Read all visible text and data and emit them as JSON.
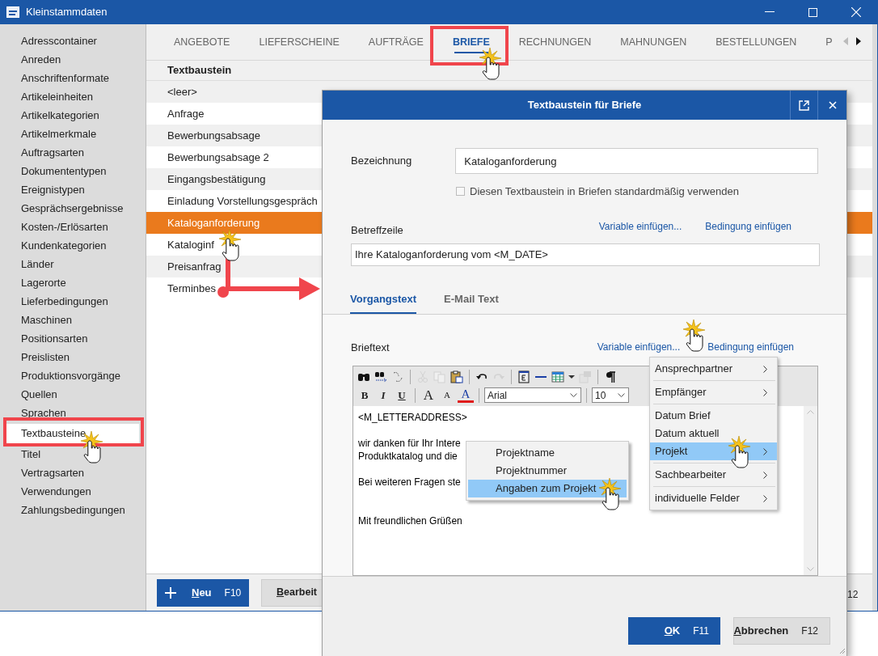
{
  "window": {
    "title": "Kleinstammdaten"
  },
  "sidebar": {
    "items": [
      {
        "label": "Adresscontainer",
        "selected": false
      },
      {
        "label": "Anreden",
        "selected": false
      },
      {
        "label": "Anschriftenformate",
        "selected": false
      },
      {
        "label": "Artikeleinheiten",
        "selected": false
      },
      {
        "label": "Artikelkategorien",
        "selected": false
      },
      {
        "label": "Artikelmerkmale",
        "selected": false
      },
      {
        "label": "Auftragsarten",
        "selected": false
      },
      {
        "label": "Dokumententypen",
        "selected": false
      },
      {
        "label": "Ereignistypen",
        "selected": false
      },
      {
        "label": "Gesprächsergebnisse",
        "selected": false
      },
      {
        "label": "Kosten-/Erlösarten",
        "selected": false
      },
      {
        "label": "Kundenkategorien",
        "selected": false
      },
      {
        "label": "Länder",
        "selected": false
      },
      {
        "label": "Lagerorte",
        "selected": false
      },
      {
        "label": "Lieferbedingungen",
        "selected": false
      },
      {
        "label": "Maschinen",
        "selected": false
      },
      {
        "label": "Positionsarten",
        "selected": false
      },
      {
        "label": "Preislisten",
        "selected": false
      },
      {
        "label": "Produktionsvorgänge",
        "selected": false
      },
      {
        "label": "Quellen",
        "selected": false
      },
      {
        "label": "Sprachen",
        "selected": false
      },
      {
        "label": "Textbausteine",
        "selected": true
      },
      {
        "label": "Titel",
        "selected": false
      },
      {
        "label": "Vertragsarten",
        "selected": false
      },
      {
        "label": "Verwendungen",
        "selected": false
      },
      {
        "label": "Zahlungsbedingungen",
        "selected": false
      }
    ]
  },
  "tabs": [
    {
      "label": "ANGEBOTE",
      "selected": false
    },
    {
      "label": "LIEFERSCHEINE",
      "selected": false
    },
    {
      "label": "AUFTRÄGE",
      "selected": false
    },
    {
      "label": "BRIEFE",
      "selected": true
    },
    {
      "label": "RECHNUNGEN",
      "selected": false
    },
    {
      "label": "MAHNUNGEN",
      "selected": false
    },
    {
      "label": "BESTELLUNGEN",
      "selected": false
    },
    {
      "label": "P",
      "selected": false
    }
  ],
  "list": {
    "header": "Textbaustein",
    "rows": [
      {
        "label": "<leer>",
        "selected": false
      },
      {
        "label": "Anfrage",
        "selected": false
      },
      {
        "label": "Bewerbungsabsage",
        "selected": false
      },
      {
        "label": "Bewerbungsabsage 2",
        "selected": false
      },
      {
        "label": "Eingangsbestätigung",
        "selected": false
      },
      {
        "label": "Einladung Vorstellungsgespräch",
        "selected": false
      },
      {
        "label": "Kataloganforderung",
        "selected": true
      },
      {
        "label": "Kataloginf",
        "selected": false
      },
      {
        "label": "Preisanfrag",
        "selected": false
      },
      {
        "label": "Terminbes",
        "selected": false
      }
    ]
  },
  "bottom_bar": {
    "buttons": [
      {
        "label": "Neu",
        "key": "F10",
        "kind": "primary"
      },
      {
        "label": "Bearbeit",
        "kind": "secondary"
      }
    ],
    "cut_key": "12"
  },
  "dialog": {
    "title": "Textbaustein für Briefe",
    "name_label": "Bezeichnung",
    "name_value": "Kataloganforderung",
    "default_checkbox": {
      "label": "Diesen Textbaustein in Briefen standardmäßig verwenden",
      "checked": false
    },
    "subject_label": "Betreffzeile",
    "subject_links": [
      "Variable einfügen...",
      "Bedingung einfügen"
    ],
    "subject_value": "Ihre Kataloganforderung vom <M_DATE>",
    "tabs": [
      {
        "label": "Vorgangstext",
        "selected": true
      },
      {
        "label": "E-Mail Text",
        "selected": false
      }
    ],
    "body_label": "Brieftext",
    "body_links": [
      "Variable einfügen...",
      "Bedingung einfügen"
    ],
    "toolbar": {
      "row1": [
        {
          "kind": "find",
          "disabled": false
        },
        {
          "kind": "find-next",
          "disabled": false
        },
        {
          "kind": "replace",
          "disabled": false
        },
        {
          "kind": "sep"
        },
        {
          "kind": "cut",
          "disabled": true
        },
        {
          "kind": "copy",
          "disabled": true
        },
        {
          "kind": "paste",
          "disabled": false
        },
        {
          "kind": "sep"
        },
        {
          "kind": "undo",
          "disabled": false
        },
        {
          "kind": "redo",
          "disabled": true
        },
        {
          "kind": "sep"
        },
        {
          "kind": "field",
          "disabled": false
        },
        {
          "kind": "rule",
          "disabled": false
        },
        {
          "kind": "table",
          "disabled": false
        },
        {
          "kind": "caret",
          "disabled": false
        },
        {
          "kind": "properties",
          "disabled": true
        },
        {
          "kind": "sep"
        },
        {
          "kind": "pilcrow",
          "disabled": false
        }
      ],
      "row2": [
        {
          "kind": "bold",
          "glyph": "B"
        },
        {
          "kind": "italic",
          "glyph": "I"
        },
        {
          "kind": "underline",
          "glyph": "U"
        },
        {
          "kind": "sep"
        },
        {
          "kind": "grow",
          "glyph": "A"
        },
        {
          "kind": "shrink",
          "glyph": "A"
        },
        {
          "kind": "color",
          "glyph": "A"
        },
        {
          "kind": "sep"
        }
      ],
      "font": "Arial",
      "size": "10"
    },
    "body_lines": [
      {
        "kind": "text",
        "text": "<M_LETTERADDRESS>"
      },
      {
        "kind": "gap"
      },
      {
        "kind": "text",
        "text": "wir danken für Ihr Intere"
      },
      {
        "kind": "text",
        "text": "Produktkatalog und die"
      },
      {
        "kind": "gap"
      },
      {
        "kind": "text",
        "text": "Bei weiteren Fragen ste"
      },
      {
        "kind": "gap"
      },
      {
        "kind": "gap"
      },
      {
        "kind": "text",
        "text": "Mit freundlichen Grüßen"
      }
    ],
    "buttons": [
      {
        "label": "OK",
        "key": "F11",
        "kind": "primary"
      },
      {
        "label": "Abbrechen",
        "key": "F12",
        "kind": "secondary"
      }
    ]
  },
  "variable_menu": {
    "groups": [
      [
        {
          "label": "Ansprechpartner",
          "has_submenu": true,
          "selected": false
        }
      ],
      [
        {
          "label": "Empfänger",
          "has_submenu": true,
          "selected": false
        }
      ],
      [
        {
          "label": "Datum Brief",
          "has_submenu": false,
          "selected": false
        },
        {
          "label": "Datum aktuell",
          "has_submenu": false,
          "selected": false
        },
        {
          "label": "Projekt",
          "has_submenu": true,
          "selected": true
        }
      ],
      [
        {
          "label": "Sachbearbeiter",
          "has_submenu": true,
          "selected": false
        }
      ],
      [
        {
          "label": "individuelle Felder",
          "has_submenu": true,
          "selected": false
        }
      ]
    ]
  },
  "project_menu": {
    "items": [
      {
        "label": "Projektname",
        "selected": false
      },
      {
        "label": "Projektnummer",
        "selected": false
      },
      {
        "label": "Angaben zum Projekt",
        "selected": true
      }
    ]
  }
}
